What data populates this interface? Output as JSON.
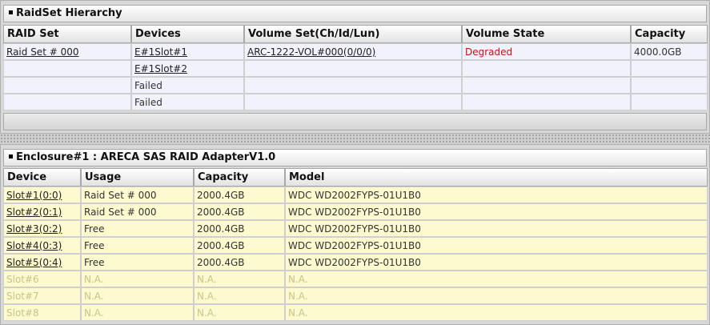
{
  "raidset": {
    "title": "RaidSet Hierarchy",
    "headers": [
      "RAID Set",
      "Devices",
      "Volume Set(Ch/Id/Lun)",
      "Volume State",
      "Capacity"
    ],
    "rows": [
      {
        "raid_set": "Raid Set # 000",
        "device": "E#1Slot#1",
        "volume": "ARC-1222-VOL#000(0/0/0)",
        "state": "Degraded",
        "capacity": "4000.0GB"
      },
      {
        "raid_set": "",
        "device": "E#1Slot#2",
        "volume": "",
        "state": "",
        "capacity": ""
      },
      {
        "raid_set": "",
        "device": "Failed",
        "volume": "",
        "state": "",
        "capacity": ""
      },
      {
        "raid_set": "",
        "device": "Failed",
        "volume": "",
        "state": "",
        "capacity": ""
      }
    ]
  },
  "enclosure": {
    "title": "Enclosure#1 : ARECA SAS RAID AdapterV1.0",
    "headers": [
      "Device",
      "Usage",
      "Capacity",
      "Model"
    ],
    "rows": [
      {
        "device": "Slot#1(0:0)",
        "usage": "Raid Set # 000",
        "capacity": "2000.4GB",
        "model": "WDC WD2002FYPS-01U1B0"
      },
      {
        "device": "Slot#2(0:1)",
        "usage": "Raid Set # 000",
        "capacity": "2000.4GB",
        "model": "WDC WD2002FYPS-01U1B0"
      },
      {
        "device": "Slot#3(0:2)",
        "usage": "Free",
        "capacity": "2000.4GB",
        "model": "WDC WD2002FYPS-01U1B0"
      },
      {
        "device": "Slot#4(0:3)",
        "usage": "Free",
        "capacity": "2000.4GB",
        "model": "WDC WD2002FYPS-01U1B0"
      },
      {
        "device": "Slot#5(0:4)",
        "usage": "Free",
        "capacity": "2000.4GB",
        "model": "WDC WD2002FYPS-01U1B0"
      },
      {
        "device": "Slot#6",
        "usage": "N.A.",
        "capacity": "N.A.",
        "model": "N.A."
      },
      {
        "device": "Slot#7",
        "usage": "N.A.",
        "capacity": "N.A.",
        "model": "N.A."
      },
      {
        "device": "Slot#8",
        "usage": "N.A.",
        "capacity": "N.A.",
        "model": "N.A."
      }
    ]
  },
  "colors": {
    "degraded": "#d01010",
    "raid_row_bg": "#f2f2fc",
    "enclosure_row_bg": "#fdfad0",
    "not_available_text": "#c9c48a"
  }
}
